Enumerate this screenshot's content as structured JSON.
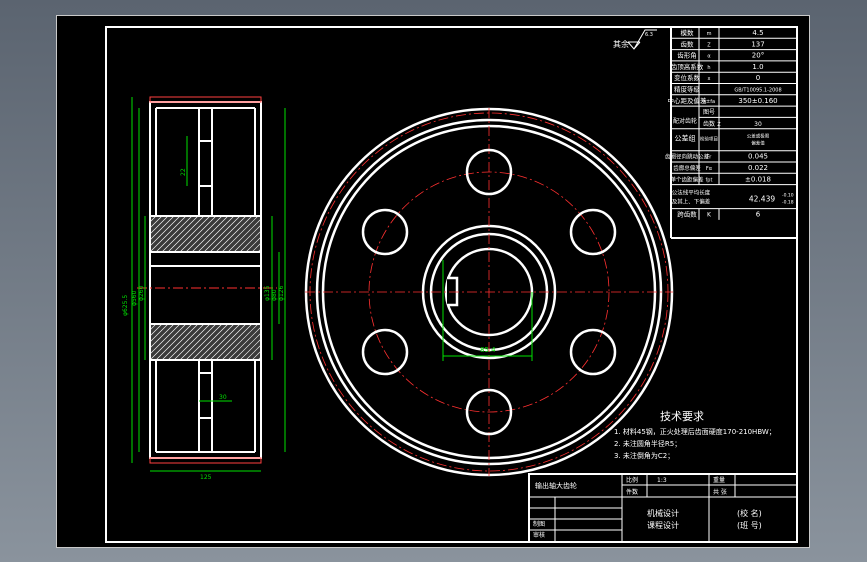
{
  "surface_mark": {
    "label": "其余",
    "value": "6.3"
  },
  "params": [
    {
      "name": "模数",
      "sym": "m",
      "val": "4.5"
    },
    {
      "name": "齿数",
      "sym": "Z",
      "val": "137"
    },
    {
      "name": "齿形角",
      "sym": "α",
      "val": "20°"
    },
    {
      "name": "齿顶高系数",
      "sym": "h",
      "val": "1.0"
    },
    {
      "name": "变位系数",
      "sym": "x",
      "val": "0"
    },
    {
      "name": "精度等级",
      "sym": "",
      "val": "GB/T10095.1-2008"
    },
    {
      "name": "中心距及偏差",
      "sym": "a±fa",
      "val": "350±0.160"
    }
  ],
  "mate": {
    "name": "配对齿轮",
    "row1_sym": "图号",
    "row1_val": "",
    "row2_sym": "齿数",
    "row2_sym2": "Z",
    "row2_val": "30"
  },
  "tolerance_group": {
    "name": "公差组",
    "sym": "检验项目",
    "val1": "公差或极限",
    "val2": "偏差值"
  },
  "checks": [
    {
      "name": "齿圈径向跳动公差",
      "sym": "Fr",
      "val": "0.045"
    },
    {
      "name": "齿廓总偏差",
      "sym": "Fα",
      "val": "0.022"
    },
    {
      "name": "单个齿距偏差",
      "sym": "fpt",
      "val": "±0.018"
    }
  ],
  "span": {
    "name1": "公法线平均长度",
    "name2": "及其上、下偏差",
    "val": "42.439",
    "sup": "-0.10",
    "sub": "-0.18"
  },
  "span_teeth": {
    "name": "跨齿数",
    "sym": "K",
    "val": "6"
  },
  "tech": {
    "title": "技术要求",
    "items": [
      "1. 材料45钢，正火处理后齿面硬度170-210HBW；",
      "2. 未注圆角半径R5；",
      "3. 未注倒角为C2；"
    ]
  },
  "title_block": {
    "part_name": "输出轴大齿轮",
    "label_scale": "比例",
    "scale": "1:3",
    "label_qty": "件数",
    "label_drawn": "制图",
    "label_checked": "审核",
    "label_weight": "重量",
    "label_sheet": "共 张",
    "course1": "机械设计",
    "course2": "课程设计",
    "school": "(校 名)",
    "class": "(班 号)"
  },
  "dims": {
    "width": "125",
    "bore": "φ80",
    "bore_depth": "φ135",
    "od": "φ625.5",
    "hub": "φ126",
    "web": "φ260",
    "rim": "φ560",
    "key": "85.4",
    "web_t": "30",
    "key_w": "22"
  }
}
